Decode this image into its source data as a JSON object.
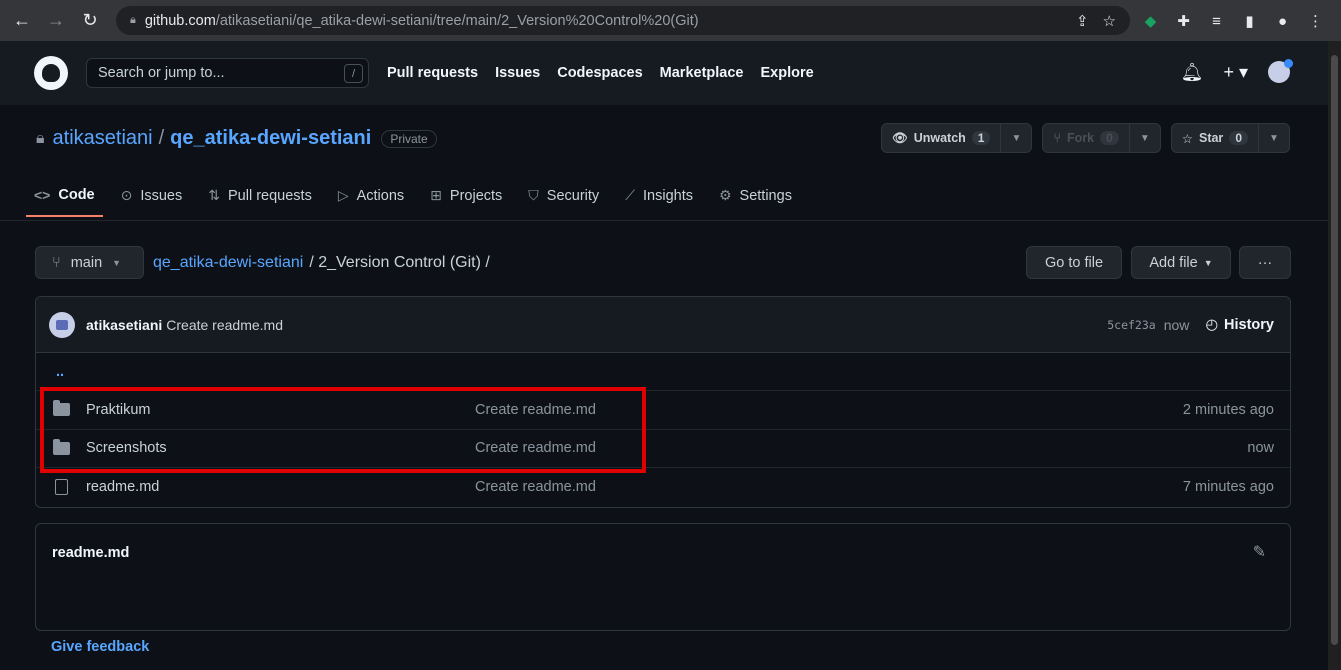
{
  "browser": {
    "url_host": "github.com",
    "url_path": "/atikasetiani/qe_atika-dewi-setiani/tree/main/2_Version%20Control%20(Git)"
  },
  "header": {
    "search_placeholder": "Search or jump to...",
    "search_shortcut": "/",
    "nav": [
      "Pull requests",
      "Issues",
      "Codespaces",
      "Marketplace",
      "Explore"
    ]
  },
  "repo": {
    "owner": "atikasetiani",
    "separator": "/",
    "name": "qe_atika-dewi-setiani",
    "visibility": "Private",
    "watch_label": "Unwatch",
    "watch_count": "1",
    "fork_label": "Fork",
    "fork_count": "0",
    "star_label": "Star",
    "star_count": "0",
    "tabs": [
      "Code",
      "Issues",
      "Pull requests",
      "Actions",
      "Projects",
      "Security",
      "Insights",
      "Settings"
    ]
  },
  "filenav": {
    "branch": "main",
    "crumb_repo": "qe_atika-dewi-setiani",
    "crumb_path": "/ 2_Version Control (Git) /",
    "go_to_file": "Go to file",
    "add_file": "Add file",
    "more": "···"
  },
  "commit": {
    "author": "atikasetiani",
    "message": "Create readme.md",
    "sha": "5cef23a",
    "when": "now",
    "history": "History"
  },
  "files": {
    "up": "..",
    "rows": [
      {
        "name": "Praktikum",
        "commit": "Create readme.md",
        "time": "2 minutes ago",
        "type": "folder"
      },
      {
        "name": "Screenshots",
        "commit": "Create readme.md",
        "time": "now",
        "type": "folder"
      },
      {
        "name": "readme.md",
        "commit": "Create readme.md",
        "time": "7 minutes ago",
        "type": "file"
      }
    ]
  },
  "readme": {
    "title": "readme.md"
  },
  "footer": {
    "feedback": "Give feedback"
  },
  "colors": {
    "highlight": "#e00000",
    "link": "#58a6ff",
    "tab_underline": "#f78166"
  }
}
